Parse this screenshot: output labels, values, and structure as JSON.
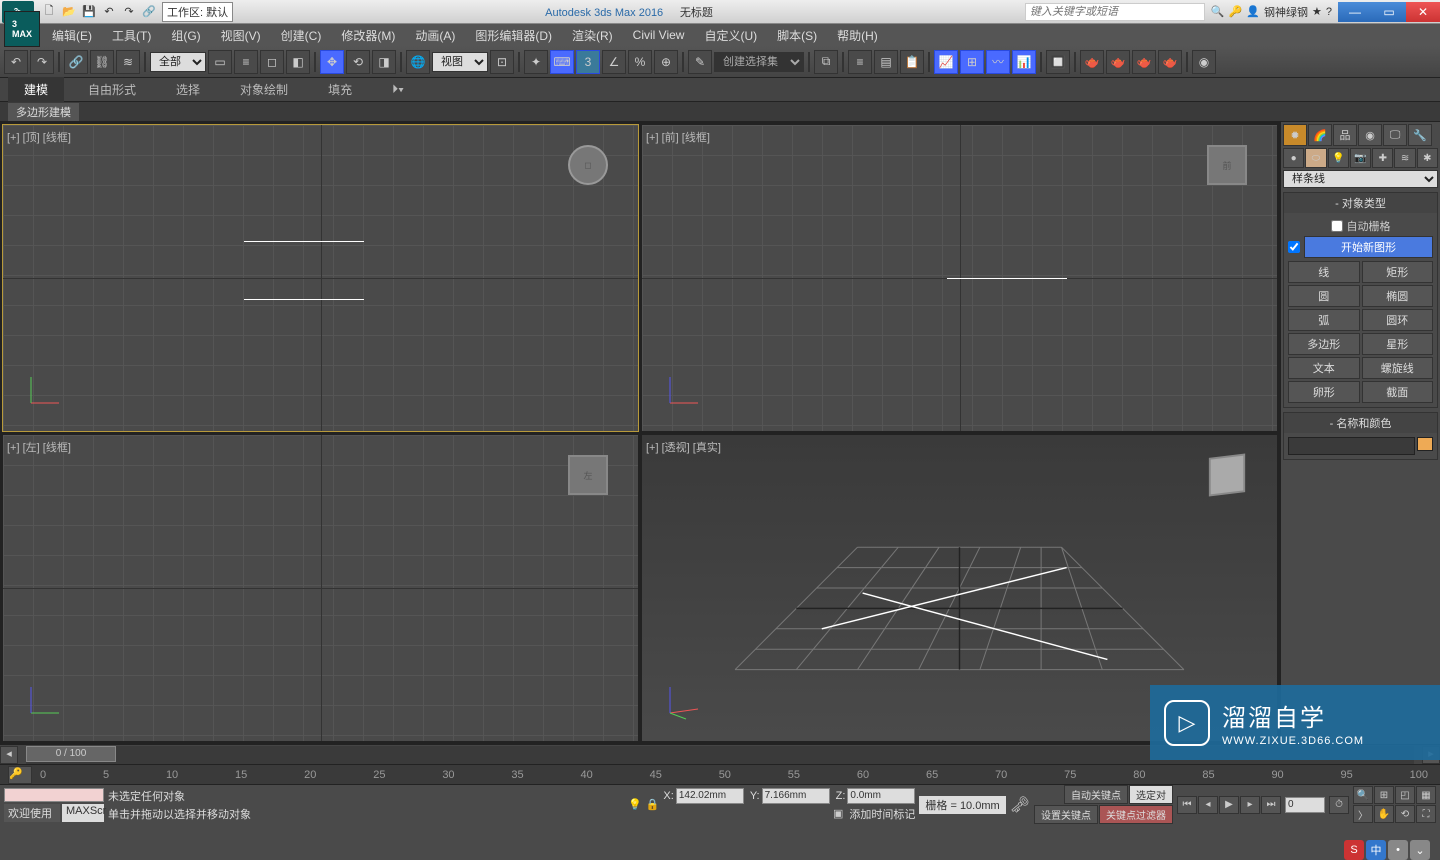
{
  "title": {
    "app": "Autodesk 3ds Max 2016",
    "doc": "无标题"
  },
  "workspace": {
    "label": "工作区: 默认"
  },
  "search": {
    "placeholder": "键入关键字或短语"
  },
  "user": {
    "name": "钢神绿钢"
  },
  "menu": [
    "编辑(E)",
    "工具(T)",
    "组(G)",
    "视图(V)",
    "创建(C)",
    "修改器(M)",
    "动画(A)",
    "图形编辑器(D)",
    "渲染(R)",
    "Civil View",
    "自定义(U)",
    "脚本(S)",
    "帮助(H)"
  ],
  "toolbar": {
    "selection_filter": "全部",
    "ref_coord": "视图",
    "named_sel": "创建选择集"
  },
  "ribbon": {
    "tabs": [
      "建模",
      "自由形式",
      "选择",
      "对象绘制",
      "填充"
    ],
    "sub": "多边形建模"
  },
  "viewports": {
    "top": "[+] [顶] [线框]",
    "front": "[+] [前] [线框]",
    "left": "[+] [左] [线框]",
    "persp": "[+] [透视] [真实]",
    "cube_front": "前",
    "cube_left": "左"
  },
  "cmd": {
    "category": "样条线",
    "rollout_type": "对象类型",
    "autogrid": "自动栅格",
    "start_new": "开始新图形",
    "buttons": [
      "线",
      "矩形",
      "圆",
      "椭圆",
      "弧",
      "圆环",
      "多边形",
      "星形",
      "文本",
      "螺旋线",
      "卵形",
      "截面"
    ],
    "rollout_name": "名称和颜色"
  },
  "timeline": {
    "thumb": "0 / 100",
    "ticks": [
      "0",
      "5",
      "10",
      "15",
      "20",
      "25",
      "30",
      "35",
      "40",
      "45",
      "50",
      "55",
      "60",
      "65",
      "70",
      "75",
      "80",
      "85",
      "90",
      "95",
      "100"
    ]
  },
  "status": {
    "no_sel": "未选定任何对象",
    "prompt": "单击并拖动以选择并移动对象",
    "welcome": "欢迎使用",
    "maxscr": "MAXScr",
    "x": "142.02mm",
    "y": "7.166mm",
    "z": "0.0mm",
    "grid": "栅格 = 10.0mm",
    "add_time": "添加时间标记",
    "autokey": "自动关键点",
    "setkey": "设置关键点",
    "selected": "选定对",
    "keyfilter": "关键点过滤器"
  },
  "watermark": {
    "brand": "溜溜自学",
    "url": "WWW.ZIXUE.3D66.COM"
  },
  "ime": {
    "c1": "S",
    "c2": "中",
    "c3": "•"
  }
}
